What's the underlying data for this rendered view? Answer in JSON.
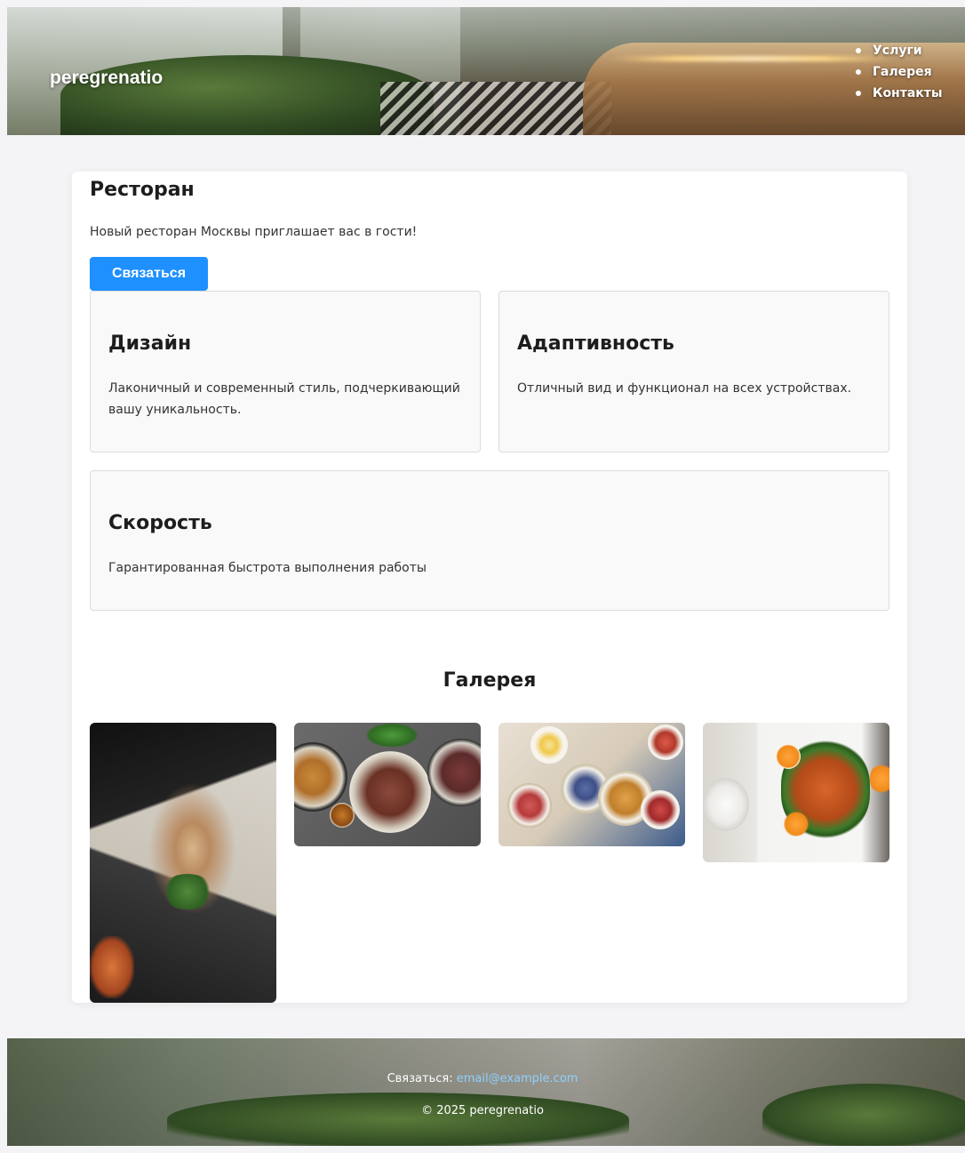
{
  "header": {
    "logo": "peregrenatio",
    "nav": [
      "Услуги",
      "Галерея",
      "Контакты"
    ]
  },
  "main": {
    "title": "Ресторан",
    "intro": "Новый ресторан Москвы приглашает вас в гости!",
    "contact_button": "Связаться",
    "features": [
      {
        "title": "Дизайн",
        "text": "Лаконичный и современный стиль, подчеркивающий вашу уникальность."
      },
      {
        "title": "Адаптивность",
        "text": "Отличный вид и функционал на всех устройствах."
      },
      {
        "title": "Скорость",
        "text": "Гарантированная быстрота выполнения работы"
      }
    ],
    "gallery_title": "Галерея",
    "gallery_images": [
      "chef-cutting-herbs-image",
      "grilled-meat-plates-image",
      "brunch-table-image",
      "orange-chicken-plate-image"
    ]
  },
  "footer": {
    "contact_label": "Связаться:",
    "email": "email@example.com",
    "copyright": "© 2025 peregrenatio"
  },
  "colors": {
    "accent": "#1e90ff",
    "page_background": "#f4f4f6",
    "card_background": "#f9f9f9",
    "link": "#8fd0ff"
  }
}
